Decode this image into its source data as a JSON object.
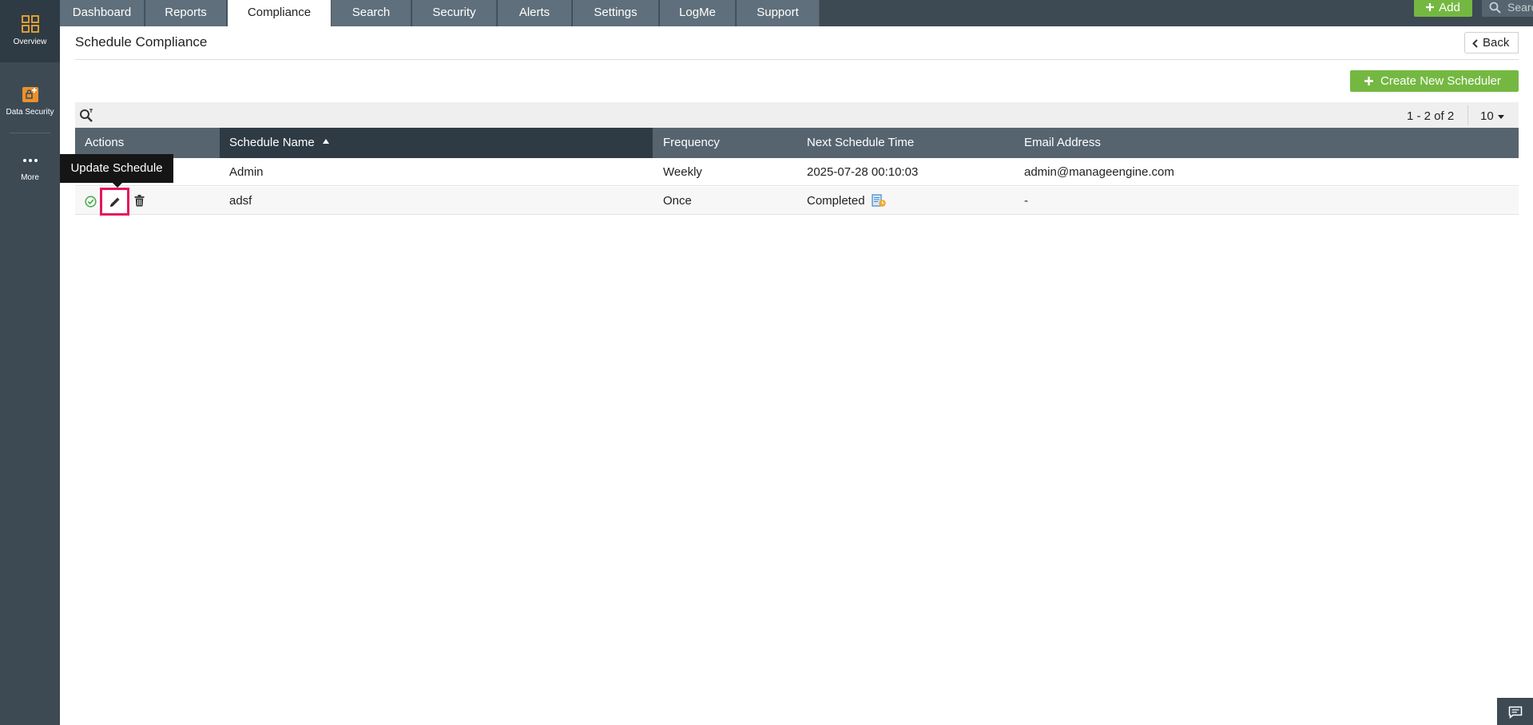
{
  "sidebar": {
    "items": [
      {
        "label": "Overview",
        "icon": "grid-icon"
      },
      {
        "label": "Data Security",
        "icon": "data-security-icon"
      },
      {
        "label": "More",
        "icon": "ellipsis-icon"
      }
    ]
  },
  "topnav": {
    "tabs": [
      {
        "label": "Dashboard"
      },
      {
        "label": "Reports"
      },
      {
        "label": "Compliance"
      },
      {
        "label": "Search"
      },
      {
        "label": "Security"
      },
      {
        "label": "Alerts"
      },
      {
        "label": "Settings"
      },
      {
        "label": "LogMe"
      },
      {
        "label": "Support"
      }
    ],
    "active_tab": "Compliance",
    "add_label": "Add",
    "search_placeholder": "Search"
  },
  "page": {
    "title": "Schedule Compliance",
    "back_label": "Back",
    "create_label": "Create New Scheduler"
  },
  "pager": {
    "range": "1 - 2 of 2",
    "per_page": "10"
  },
  "table": {
    "columns": [
      "Actions",
      "Schedule Name",
      "Frequency",
      "Next Schedule Time",
      "Email Address"
    ],
    "sorted_column": "Schedule Name",
    "rows": [
      {
        "name": "Admin",
        "frequency": "Weekly",
        "next_time": "2025-07-28 00:10:03",
        "email": "admin@manageengine.com"
      },
      {
        "name": "adsf",
        "frequency": "Once",
        "next_time": "Completed",
        "email": "-"
      }
    ]
  },
  "tooltip": {
    "text": "Update Schedule"
  },
  "colors": {
    "accent_green": "#74b842",
    "nav_dark": "#3d4a54",
    "highlight_red": "#e5175b"
  }
}
